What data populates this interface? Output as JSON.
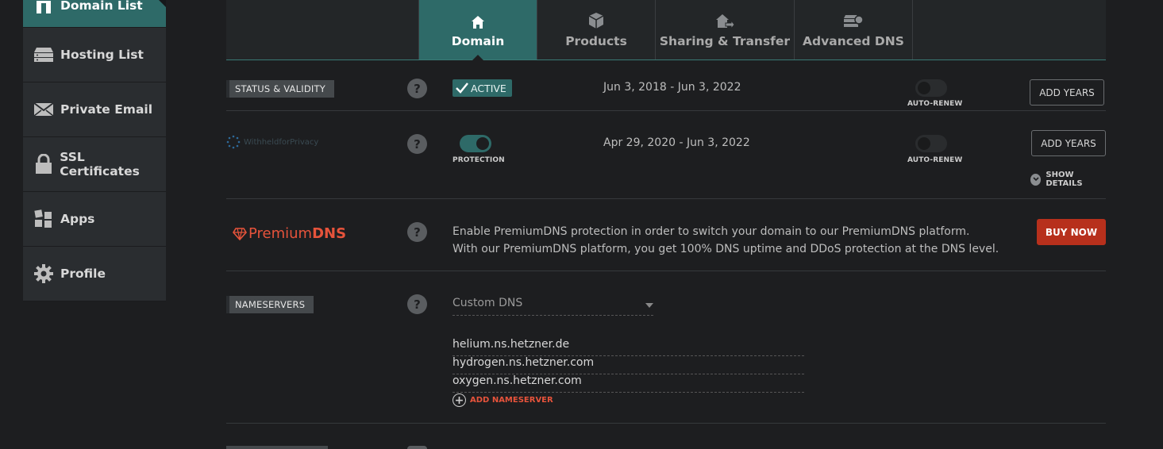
{
  "sidebar": {
    "items": [
      {
        "label": "Domain List",
        "icon": "domain-icon"
      },
      {
        "label": "Hosting List",
        "icon": "server-icon"
      },
      {
        "label": "Private Email",
        "icon": "envelope-icon"
      },
      {
        "label": "SSL Certificates",
        "icon": "lock-icon"
      },
      {
        "label": "Apps",
        "icon": "apps-icon"
      },
      {
        "label": "Profile",
        "icon": "gear-icon"
      }
    ]
  },
  "tabs": [
    {
      "label": "Domain",
      "icon": "home-icon"
    },
    {
      "label": "Products",
      "icon": "box-icon"
    },
    {
      "label": "Sharing & Transfer",
      "icon": "transfer-icon"
    },
    {
      "label": "Advanced DNS",
      "icon": "dns-server-icon"
    }
  ],
  "status": {
    "tag": "STATUS & VALIDITY",
    "badge": "ACTIVE",
    "dates": "Jun 3, 2018 - Jun 3, 2022",
    "auto_renew_label": "AUTO-RENEW",
    "add_years": "ADD YEARS"
  },
  "privacy": {
    "brand": "WithheldforPrivacy",
    "protection_label": "PROTECTION",
    "dates": "Apr 29, 2020 - Jun 3, 2022",
    "auto_renew_label": "AUTO-RENEW",
    "add_years": "ADD YEARS",
    "show_details": "SHOW DETAILS"
  },
  "premium": {
    "brand_a": "Premium",
    "brand_b": "DNS",
    "line1": "Enable PremiumDNS protection in order to switch your domain to our PremiumDNS platform.",
    "line2": "With our PremiumDNS platform, you get 100% DNS uptime and DDoS protection at the DNS level.",
    "buy": "BUY NOW"
  },
  "nameservers": {
    "tag": "NAMESERVERS",
    "selected": "Custom DNS",
    "list": [
      "helium.ns.hetzner.de",
      "hydrogen.ns.hetzner.com",
      "oxygen.ns.hetzner.com"
    ],
    "add": "ADD NAMESERVER"
  },
  "help_glyph": "?",
  "colors": {
    "accent": "#2e6a68",
    "danger": "#b7301c",
    "brand_orange": "#e6533b"
  }
}
